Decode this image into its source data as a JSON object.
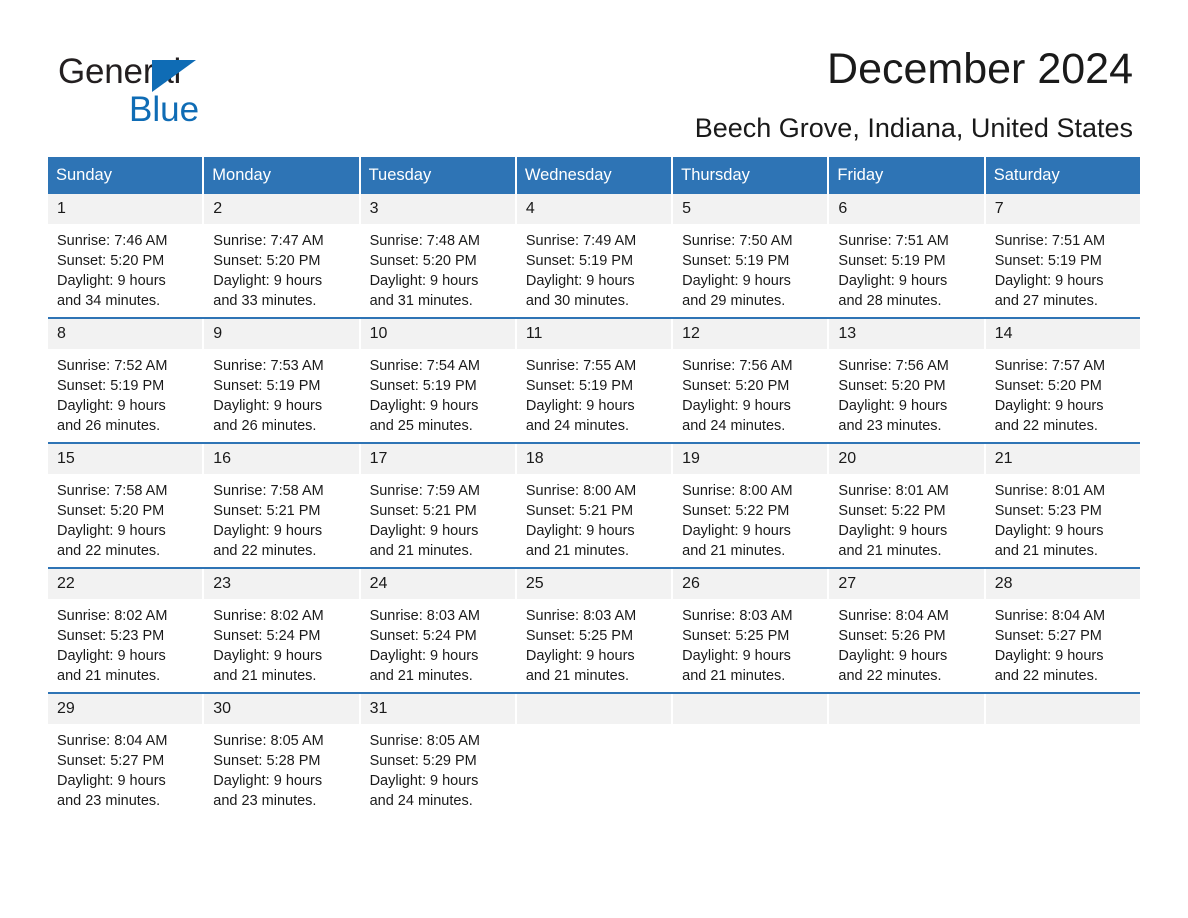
{
  "brand": {
    "line1": "General",
    "line2": "Blue",
    "triangle_icon": "triangle-icon",
    "colors": {
      "dark": "#231f20",
      "blue": "#0f6cb5"
    }
  },
  "header": {
    "title": "December 2024",
    "subtitle": "Beech Grove, Indiana, United States"
  },
  "theme": {
    "header_bar": "#2e74b5",
    "daynum_band": "#f2f2f2",
    "separator": "#2e74b5",
    "text": "#1a1a1a"
  },
  "weekday_headers": [
    "Sunday",
    "Monday",
    "Tuesday",
    "Wednesday",
    "Thursday",
    "Friday",
    "Saturday"
  ],
  "weeks": [
    [
      {
        "day": "1",
        "sunrise": "Sunrise: 7:46 AM",
        "sunset": "Sunset: 5:20 PM",
        "daylight1": "Daylight: 9 hours",
        "daylight2": "and 34 minutes."
      },
      {
        "day": "2",
        "sunrise": "Sunrise: 7:47 AM",
        "sunset": "Sunset: 5:20 PM",
        "daylight1": "Daylight: 9 hours",
        "daylight2": "and 33 minutes."
      },
      {
        "day": "3",
        "sunrise": "Sunrise: 7:48 AM",
        "sunset": "Sunset: 5:20 PM",
        "daylight1": "Daylight: 9 hours",
        "daylight2": "and 31 minutes."
      },
      {
        "day": "4",
        "sunrise": "Sunrise: 7:49 AM",
        "sunset": "Sunset: 5:19 PM",
        "daylight1": "Daylight: 9 hours",
        "daylight2": "and 30 minutes."
      },
      {
        "day": "5",
        "sunrise": "Sunrise: 7:50 AM",
        "sunset": "Sunset: 5:19 PM",
        "daylight1": "Daylight: 9 hours",
        "daylight2": "and 29 minutes."
      },
      {
        "day": "6",
        "sunrise": "Sunrise: 7:51 AM",
        "sunset": "Sunset: 5:19 PM",
        "daylight1": "Daylight: 9 hours",
        "daylight2": "and 28 minutes."
      },
      {
        "day": "7",
        "sunrise": "Sunrise: 7:51 AM",
        "sunset": "Sunset: 5:19 PM",
        "daylight1": "Daylight: 9 hours",
        "daylight2": "and 27 minutes."
      }
    ],
    [
      {
        "day": "8",
        "sunrise": "Sunrise: 7:52 AM",
        "sunset": "Sunset: 5:19 PM",
        "daylight1": "Daylight: 9 hours",
        "daylight2": "and 26 minutes."
      },
      {
        "day": "9",
        "sunrise": "Sunrise: 7:53 AM",
        "sunset": "Sunset: 5:19 PM",
        "daylight1": "Daylight: 9 hours",
        "daylight2": "and 26 minutes."
      },
      {
        "day": "10",
        "sunrise": "Sunrise: 7:54 AM",
        "sunset": "Sunset: 5:19 PM",
        "daylight1": "Daylight: 9 hours",
        "daylight2": "and 25 minutes."
      },
      {
        "day": "11",
        "sunrise": "Sunrise: 7:55 AM",
        "sunset": "Sunset: 5:19 PM",
        "daylight1": "Daylight: 9 hours",
        "daylight2": "and 24 minutes."
      },
      {
        "day": "12",
        "sunrise": "Sunrise: 7:56 AM",
        "sunset": "Sunset: 5:20 PM",
        "daylight1": "Daylight: 9 hours",
        "daylight2": "and 24 minutes."
      },
      {
        "day": "13",
        "sunrise": "Sunrise: 7:56 AM",
        "sunset": "Sunset: 5:20 PM",
        "daylight1": "Daylight: 9 hours",
        "daylight2": "and 23 minutes."
      },
      {
        "day": "14",
        "sunrise": "Sunrise: 7:57 AM",
        "sunset": "Sunset: 5:20 PM",
        "daylight1": "Daylight: 9 hours",
        "daylight2": "and 22 minutes."
      }
    ],
    [
      {
        "day": "15",
        "sunrise": "Sunrise: 7:58 AM",
        "sunset": "Sunset: 5:20 PM",
        "daylight1": "Daylight: 9 hours",
        "daylight2": "and 22 minutes."
      },
      {
        "day": "16",
        "sunrise": "Sunrise: 7:58 AM",
        "sunset": "Sunset: 5:21 PM",
        "daylight1": "Daylight: 9 hours",
        "daylight2": "and 22 minutes."
      },
      {
        "day": "17",
        "sunrise": "Sunrise: 7:59 AM",
        "sunset": "Sunset: 5:21 PM",
        "daylight1": "Daylight: 9 hours",
        "daylight2": "and 21 minutes."
      },
      {
        "day": "18",
        "sunrise": "Sunrise: 8:00 AM",
        "sunset": "Sunset: 5:21 PM",
        "daylight1": "Daylight: 9 hours",
        "daylight2": "and 21 minutes."
      },
      {
        "day": "19",
        "sunrise": "Sunrise: 8:00 AM",
        "sunset": "Sunset: 5:22 PM",
        "daylight1": "Daylight: 9 hours",
        "daylight2": "and 21 minutes."
      },
      {
        "day": "20",
        "sunrise": "Sunrise: 8:01 AM",
        "sunset": "Sunset: 5:22 PM",
        "daylight1": "Daylight: 9 hours",
        "daylight2": "and 21 minutes."
      },
      {
        "day": "21",
        "sunrise": "Sunrise: 8:01 AM",
        "sunset": "Sunset: 5:23 PM",
        "daylight1": "Daylight: 9 hours",
        "daylight2": "and 21 minutes."
      }
    ],
    [
      {
        "day": "22",
        "sunrise": "Sunrise: 8:02 AM",
        "sunset": "Sunset: 5:23 PM",
        "daylight1": "Daylight: 9 hours",
        "daylight2": "and 21 minutes."
      },
      {
        "day": "23",
        "sunrise": "Sunrise: 8:02 AM",
        "sunset": "Sunset: 5:24 PM",
        "daylight1": "Daylight: 9 hours",
        "daylight2": "and 21 minutes."
      },
      {
        "day": "24",
        "sunrise": "Sunrise: 8:03 AM",
        "sunset": "Sunset: 5:24 PM",
        "daylight1": "Daylight: 9 hours",
        "daylight2": "and 21 minutes."
      },
      {
        "day": "25",
        "sunrise": "Sunrise: 8:03 AM",
        "sunset": "Sunset: 5:25 PM",
        "daylight1": "Daylight: 9 hours",
        "daylight2": "and 21 minutes."
      },
      {
        "day": "26",
        "sunrise": "Sunrise: 8:03 AM",
        "sunset": "Sunset: 5:25 PM",
        "daylight1": "Daylight: 9 hours",
        "daylight2": "and 21 minutes."
      },
      {
        "day": "27",
        "sunrise": "Sunrise: 8:04 AM",
        "sunset": "Sunset: 5:26 PM",
        "daylight1": "Daylight: 9 hours",
        "daylight2": "and 22 minutes."
      },
      {
        "day": "28",
        "sunrise": "Sunrise: 8:04 AM",
        "sunset": "Sunset: 5:27 PM",
        "daylight1": "Daylight: 9 hours",
        "daylight2": "and 22 minutes."
      }
    ],
    [
      {
        "day": "29",
        "sunrise": "Sunrise: 8:04 AM",
        "sunset": "Sunset: 5:27 PM",
        "daylight1": "Daylight: 9 hours",
        "daylight2": "and 23 minutes."
      },
      {
        "day": "30",
        "sunrise": "Sunrise: 8:05 AM",
        "sunset": "Sunset: 5:28 PM",
        "daylight1": "Daylight: 9 hours",
        "daylight2": "and 23 minutes."
      },
      {
        "day": "31",
        "sunrise": "Sunrise: 8:05 AM",
        "sunset": "Sunset: 5:29 PM",
        "daylight1": "Daylight: 9 hours",
        "daylight2": "and 24 minutes."
      },
      {
        "day": "",
        "sunrise": "",
        "sunset": "",
        "daylight1": "",
        "daylight2": ""
      },
      {
        "day": "",
        "sunrise": "",
        "sunset": "",
        "daylight1": "",
        "daylight2": ""
      },
      {
        "day": "",
        "sunrise": "",
        "sunset": "",
        "daylight1": "",
        "daylight2": ""
      },
      {
        "day": "",
        "sunrise": "",
        "sunset": "",
        "daylight1": "",
        "daylight2": ""
      }
    ]
  ]
}
